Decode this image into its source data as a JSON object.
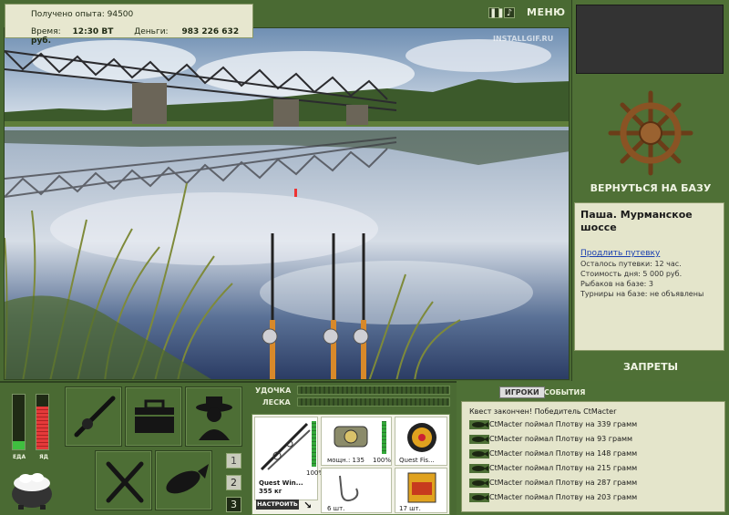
{
  "header": {
    "experience_label": "Получено опыта:",
    "experience_value": "94500",
    "time_label": "Время:",
    "time_value": "12:30 ВТ",
    "money_label": "Деньги:",
    "money_value": "983 226 632 руб.",
    "menu_label": "МЕНЮ",
    "watermark": "INSTALLGIF.RU"
  },
  "right_panel": {
    "return_label": "ВЕРНУТЬСЯ НА БАЗУ",
    "base_title": "Паша. Мурманское шоссе",
    "extend_link": "Продлить путевку",
    "lines": [
      "Осталось путевки: 12 час.",
      "Стоимость дня: 5 000 руб.",
      "Рыбаков на базе: 3",
      "Турниры на базе: не объявлены"
    ],
    "bans_label": "ЗАПРЕТЫ"
  },
  "meters": {
    "food_label": "ЕДА",
    "poison_label": "ЯД",
    "food_level": 0.15,
    "poison_level": 0.78
  },
  "pages": [
    "1",
    "2",
    "3"
  ],
  "bars": {
    "rod_label": "УДОЧКА",
    "line_label": "ЛЕСКА"
  },
  "tackle": {
    "rod_name": "Quest Win...",
    "rod_weight": "355 кг",
    "rod_percent": "100%",
    "reel_caption": "мощн.: 135",
    "reel_percent": "100%",
    "line_name": "Quest Fis...",
    "hook_count": "6 шт.",
    "bait_count": "17 шт.",
    "adjust_label": "НАСТРОИТЬ"
  },
  "log": {
    "tab_players": "ИГРОКИ",
    "tab_events": "СОБЫТИЯ",
    "entries": [
      "Квест закончен! Победитель CtMacter",
      "CtMacter поймал Плотву на 339 грамм",
      "CtMacter поймал Плотву на 93 грамм",
      "CtMacter поймал Плотву на 148 грамм",
      "CtMacter поймал Плотву на 215 грамм",
      "CtMacter поймал Плотву на 287 грамм",
      "CtMacter поймал Плотву на 203 грамм"
    ]
  }
}
